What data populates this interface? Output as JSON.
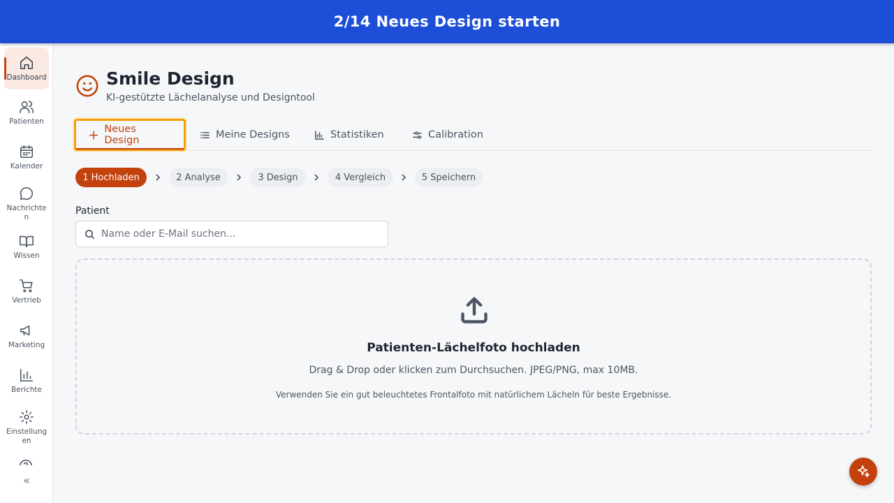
{
  "banner": {
    "text": "2/14 Neues Design starten"
  },
  "sidebar": {
    "items": [
      {
        "label": "Dashboard",
        "icon": "home-icon",
        "active": true
      },
      {
        "label": "Patienten",
        "icon": "users-icon"
      },
      {
        "label": "Kalender",
        "icon": "calendar-icon"
      },
      {
        "label": "Nachrichten",
        "icon": "message-icon"
      },
      {
        "label": "Wissen",
        "icon": "book-icon"
      },
      {
        "label": "Vertrieb",
        "icon": "cart-icon"
      },
      {
        "label": "Marketing",
        "icon": "megaphone-icon"
      },
      {
        "label": "Berichte",
        "icon": "bar-chart-icon"
      },
      {
        "label": "Einstellungen",
        "icon": "gear-icon"
      }
    ],
    "collapse_label": "«"
  },
  "header": {
    "title": "Smile Design",
    "subtitle": "KI-gestützte Lächelanalyse und Designtool",
    "icon": "smile-icon"
  },
  "tabs": [
    {
      "label": "Neues Design",
      "icon": "plus-icon",
      "active": true
    },
    {
      "label": "Meine Designs",
      "icon": "list-icon"
    },
    {
      "label": "Statistiken",
      "icon": "chart-icon"
    },
    {
      "label": "Calibration",
      "icon": "sliders-icon"
    }
  ],
  "steps": [
    {
      "label": "1 Hochladen",
      "active": true
    },
    {
      "label": "2 Analyse"
    },
    {
      "label": "3 Design"
    },
    {
      "label": "4 Vergleich"
    },
    {
      "label": "5 Speichern"
    }
  ],
  "patient": {
    "label": "Patient",
    "search_placeholder": "Name oder E-Mail suchen..."
  },
  "upload": {
    "title": "Patienten-Lächelfoto hochladen",
    "hint": "Drag & Drop oder klicken zum Durchsuchen. JPEG/PNG, max 10MB.",
    "note": "Verwenden Sie ein gut beleuchtetes Frontalfoto mit natürlichem Lächeln für beste Ergebnisse.",
    "icon": "upload-icon"
  },
  "fab": {
    "icon": "sparkles-icon"
  },
  "colors": {
    "banner": "#1d4ed8",
    "accent": "#c2410c",
    "highlight": "#f59e0b"
  }
}
